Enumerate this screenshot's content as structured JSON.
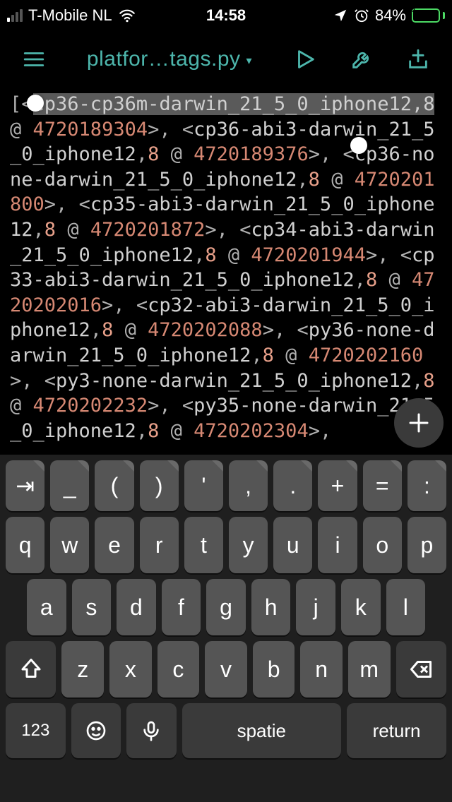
{
  "status": {
    "carrier": "T-Mobile NL",
    "time": "14:58",
    "battery_pct": "84%",
    "signal_active_bars": 1
  },
  "toolbar": {
    "title": "platfor…tags.py"
  },
  "code": {
    "platform": "darwin_21_5_0_iphone12",
    "suffix_num": "8",
    "entries": [
      {
        "label": "cp36-cp36m",
        "addr": "4720189304"
      },
      {
        "label": "cp36-abi3",
        "addr": "4720189376"
      },
      {
        "label": "cp36-none",
        "addr": "4720201800"
      },
      {
        "label": "cp35-abi3",
        "addr": "4720201872"
      },
      {
        "label": "cp34-abi3",
        "addr": "4720201944"
      },
      {
        "label": "cp33-abi3",
        "addr": "4720202016"
      },
      {
        "label": "cp32-abi3",
        "addr": "4720202088"
      },
      {
        "label": "py36-none",
        "addr": "4720202160"
      },
      {
        "label": "py3-none",
        "addr": "4720202232"
      },
      {
        "label": "py35-none",
        "addr": "4720202304"
      }
    ]
  },
  "keyboard": {
    "row_sym": [
      "⇥",
      "_",
      "(",
      ")",
      "'",
      ",",
      ".",
      "+",
      "=",
      ":"
    ],
    "row_q": [
      "q",
      "w",
      "e",
      "r",
      "t",
      "y",
      "u",
      "i",
      "o",
      "p"
    ],
    "row_a": [
      "a",
      "s",
      "d",
      "f",
      "g",
      "h",
      "j",
      "k",
      "l"
    ],
    "row_z": [
      "z",
      "x",
      "c",
      "v",
      "b",
      "n",
      "m"
    ],
    "switch_label": "123",
    "space_label": "spatie",
    "return_label": "return"
  }
}
